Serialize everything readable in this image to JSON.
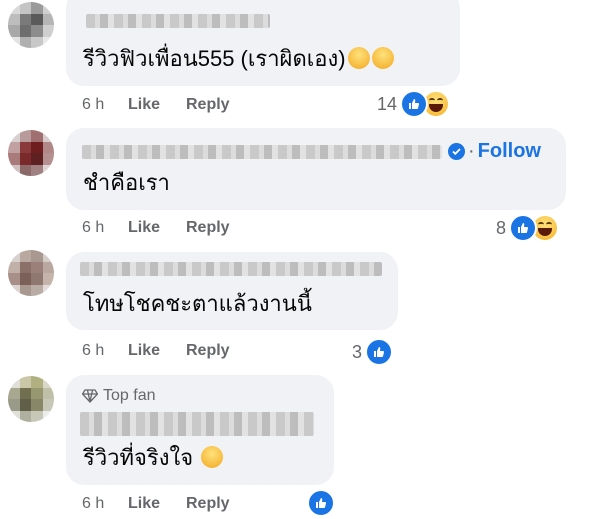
{
  "comments": [
    {
      "text": "รีวิวฟิวเพื่อน555 (เราผิดเอง)",
      "emojis": [
        "rolling-laughing-emoji",
        "grinning-sweat-emoji"
      ],
      "time": "6 h",
      "like": "Like",
      "reply": "Reply",
      "reaction_count": "14",
      "reactions": [
        "like",
        "haha"
      ]
    },
    {
      "text": "ชำคือเรา",
      "verified": true,
      "follow": "Follow",
      "time": "6 h",
      "like": "Like",
      "reply": "Reply",
      "reaction_count": "8",
      "reactions": [
        "like",
        "haha"
      ]
    },
    {
      "text": "โทษโชคชะตาแล้วงานนี้",
      "time": "6 h",
      "like": "Like",
      "reply": "Reply",
      "reaction_count": "3",
      "reactions": [
        "like"
      ]
    },
    {
      "badge": "Top fan",
      "text": "รีวิวที่จริงใจ",
      "emojis": [
        "tears-of-joy-emoji"
      ],
      "time": "6 h",
      "like": "Like",
      "reply": "Reply",
      "reaction_count": "",
      "reactions": [
        "like"
      ]
    }
  ],
  "colors": {
    "bubble": "#f0f2f5",
    "accent": "#1b74e4",
    "meta": "#65676b"
  }
}
